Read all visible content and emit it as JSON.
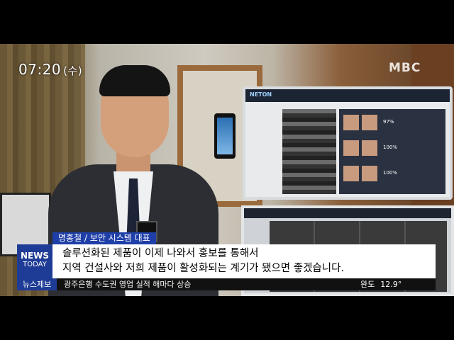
{
  "overlay": {
    "time": "07:20",
    "day": "(수)",
    "channel_logo": "MBC"
  },
  "lower_third": {
    "name_tag": "명홍철 / 보안 시스템 대표",
    "caption_line1": "솔루션화된 제품이 이제 나와서 홍보를 통해서",
    "caption_line2": "지역 건설사와 저희 제품이 활성화되는 계기가 됐으면 좋겠습니다.",
    "program_logo_line1": "NEWS",
    "program_logo_line2": "TODAY",
    "ticker_label": "뉴스제보",
    "ticker_text": "광주은행 수도권 영업 실적 해마다 상승",
    "weather_label": "완도",
    "weather_temp": "12.9°"
  },
  "screen": {
    "logo": "NETON",
    "percent_1": "97%",
    "percent_2": "100%",
    "percent_3": "100%"
  }
}
